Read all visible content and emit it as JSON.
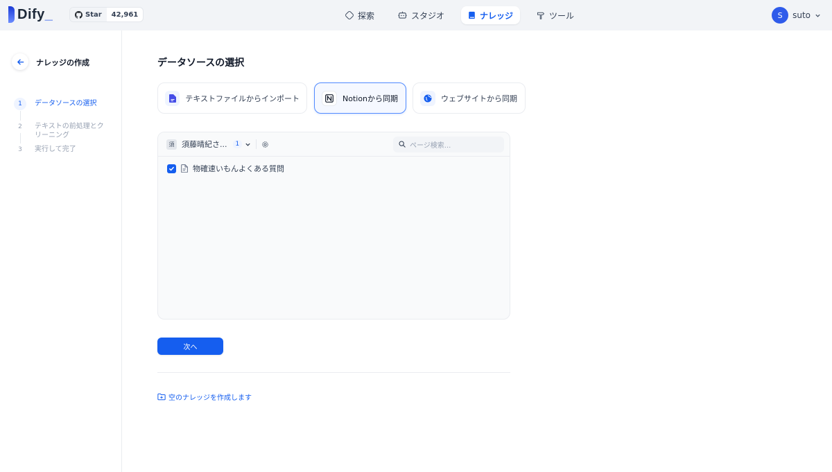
{
  "header": {
    "logo_text": "Dify",
    "github": {
      "star_label": "Star",
      "count": "42,961"
    },
    "nav": [
      {
        "label": "探索",
        "icon": "compass-icon"
      },
      {
        "label": "スタジオ",
        "icon": "robot-icon"
      },
      {
        "label": "ナレッジ",
        "icon": "book-icon",
        "active": true
      },
      {
        "label": "ツール",
        "icon": "hammer-icon"
      }
    ],
    "user": {
      "initial": "S",
      "name": "suto"
    }
  },
  "sidebar": {
    "title": "ナレッジの作成",
    "steps": [
      {
        "num": "1",
        "label": "データソースの選択",
        "active": true
      },
      {
        "num": "2",
        "label": "テキストの前処理とクリーニング"
      },
      {
        "num": "3",
        "label": "実行して完了"
      }
    ]
  },
  "main": {
    "title": "データソースの選択",
    "sources": [
      {
        "label": "テキストファイルからインポート",
        "icon": "file-icon"
      },
      {
        "label": "Notionから同期",
        "icon": "notion-icon",
        "active": true
      },
      {
        "label": "ウェブサイトから同期",
        "icon": "globe-icon"
      }
    ],
    "workspace": {
      "initial": "須",
      "name": "須藤晴紀さ...",
      "count": "1"
    },
    "search": {
      "placeholder": "ページ検索..."
    },
    "pages": [
      {
        "name": "物確速いもんよくある質問",
        "checked": true
      }
    ],
    "next_label": "次へ",
    "empty_link": "空のナレッジを作成します"
  },
  "colors": {
    "accent": "#155eef",
    "topbar_bg": "#f2f4f7"
  }
}
